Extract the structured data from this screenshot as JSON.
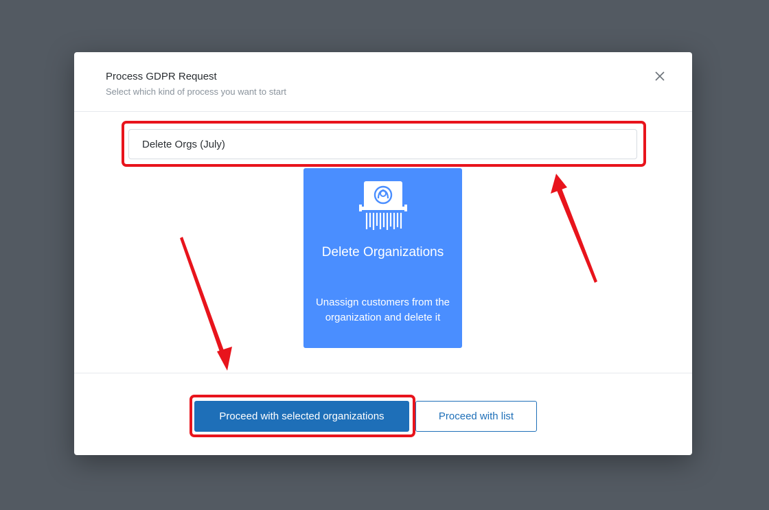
{
  "modal": {
    "title": "Process GDPR Request",
    "subtitle": "Select which kind of process you want to start",
    "close_icon": "close-icon"
  },
  "process_name_input": {
    "value": "Delete Orgs (July)"
  },
  "process_card": {
    "icon": "shredder-icon",
    "title": "Delete Organizations",
    "description": "Unassign customers from the organization and delete it",
    "color": "#4a8eff"
  },
  "footer": {
    "primary_label": "Proceed with selected organizations",
    "secondary_label": "Proceed with list"
  },
  "colors": {
    "backdrop": "#535a62",
    "primary": "#1e6fb8",
    "annotation": "#e8141c"
  }
}
